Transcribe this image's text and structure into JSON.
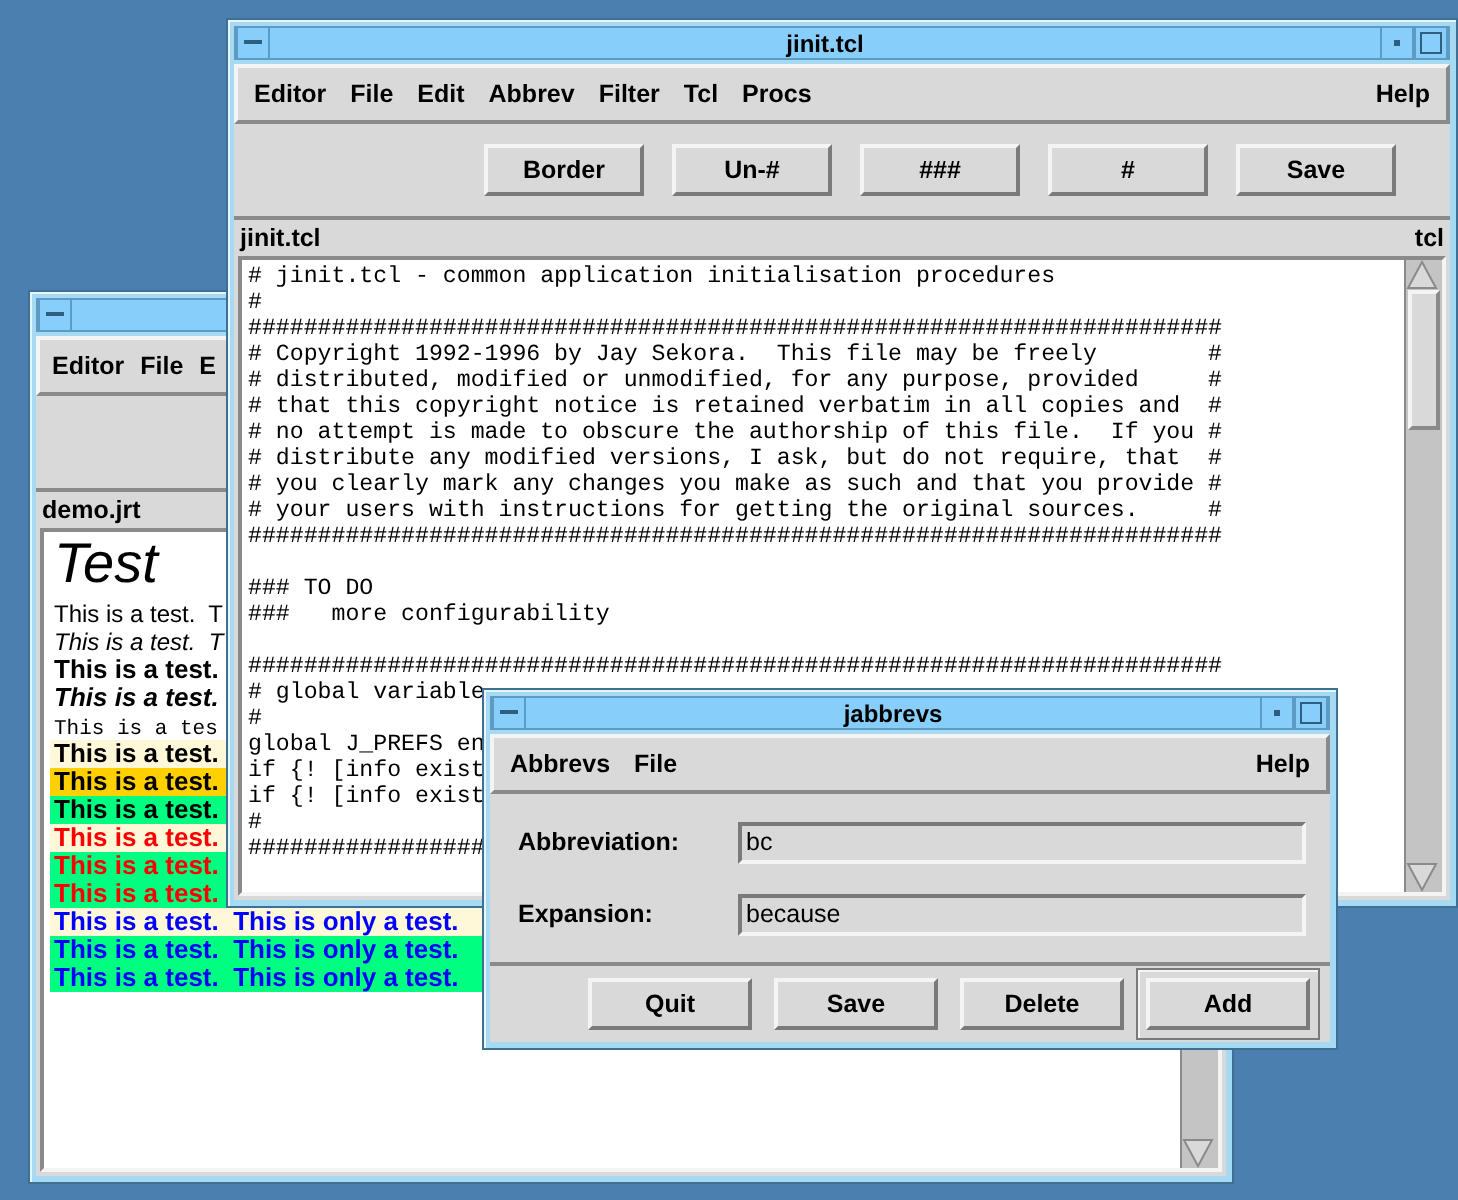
{
  "demo": {
    "menu": [
      {
        "label": "Editor"
      },
      {
        "label": "File"
      },
      {
        "label": "E"
      }
    ],
    "file_label": "demo.jrt",
    "lines": [
      {
        "kind": "heading",
        "text": "Test"
      },
      {
        "kind": "plain",
        "text": "This is a test.  T"
      },
      {
        "kind": "italic",
        "text": "This is a test.  T"
      },
      {
        "kind": "bold",
        "text": "This is a test."
      },
      {
        "kind": "bold-italic",
        "text": "This is a test."
      },
      {
        "kind": "mono",
        "text": "This is a tes"
      },
      {
        "kind": "bold",
        "text": "This is a test.",
        "band": {
          "color": "#fff8d8"
        }
      },
      {
        "kind": "bold",
        "text": "This is a test.",
        "band": {
          "color": "#ffd000"
        }
      },
      {
        "kind": "bold",
        "text": "This is a test.",
        "band": {
          "color": "#00ff80"
        }
      },
      {
        "kind": "bold",
        "text": "This is a test.",
        "color": "#ff0000",
        "band": {
          "color": "#fff8d8"
        }
      },
      {
        "kind": "bold",
        "text": "This is a test.",
        "color": "#ff0000",
        "band": {
          "color": "#00ff80"
        }
      },
      {
        "kind": "bold",
        "text": "This is a test.",
        "color": "#ff0000",
        "band": {
          "color": "#00ff80"
        }
      },
      {
        "kind": "bold",
        "text": "This is a test.  This is only a test.",
        "color": "#0000ff",
        "band": {
          "color": "#fff8d8"
        }
      },
      {
        "kind": "bold",
        "text": "This is a test.  This is only a test.",
        "color": "#0000ff",
        "band": {
          "color": "#00ff80"
        }
      },
      {
        "kind": "bold",
        "text": "This is a test.  This is only a test.",
        "color": "#0000ff",
        "band": {
          "color": "#00ff80"
        }
      }
    ]
  },
  "jinit": {
    "title": "jinit.tcl",
    "menu": [
      {
        "label": "Editor"
      },
      {
        "label": "File"
      },
      {
        "label": "Edit"
      },
      {
        "label": "Abbrev"
      },
      {
        "label": "Filter"
      },
      {
        "label": "Tcl"
      },
      {
        "label": "Procs"
      }
    ],
    "help": "Help",
    "toolbar": [
      {
        "label": "Border"
      },
      {
        "label": "Un-#"
      },
      {
        "label": "###"
      },
      {
        "label": "#"
      },
      {
        "label": "Save"
      }
    ],
    "file_label": "jinit.tcl",
    "mode_label": "tcl",
    "code_blocks": [
      [
        "# jinit.tcl - common application initialisation procedures",
        "#",
        "######################################################################",
        "# Copyright 1992-1996 by Jay Sekora.  This file may be freely        #",
        "# distributed, modified or unmodified, for any purpose, provided     #",
        "# that this copyright notice is retained verbatim in all copies and  #",
        "# no attempt is made to obscure the authorship of this file.  If you #",
        "# distribute any modified versions, I ask, but do not require, that  #",
        "# you clearly mark any changes you make as such and that you provide #",
        "# your users with instructions for getting the original sources.     #",
        "######################################################################"
      ],
      [
        "### TO DO",
        "###   more configurability"
      ],
      [
        "######################################################################",
        "# global variable",
        "#",
        "global J_PREFS en",
        "if {! [info exist",
        "if {! [info exist",
        "#",
        "#################"
      ]
    ]
  },
  "jabbrevs": {
    "title": "jabbrevs",
    "menu": [
      {
        "label": "Abbrevs"
      },
      {
        "label": "File"
      }
    ],
    "help": "Help",
    "fields": [
      {
        "label": "Abbreviation:",
        "value": "bc"
      },
      {
        "label": "Expansion:",
        "value": "because"
      }
    ],
    "buttons": [
      {
        "label": "Quit",
        "default": false
      },
      {
        "label": "Save",
        "default": false
      },
      {
        "label": "Delete",
        "default": false
      },
      {
        "label": "Add",
        "default": true
      }
    ]
  }
}
